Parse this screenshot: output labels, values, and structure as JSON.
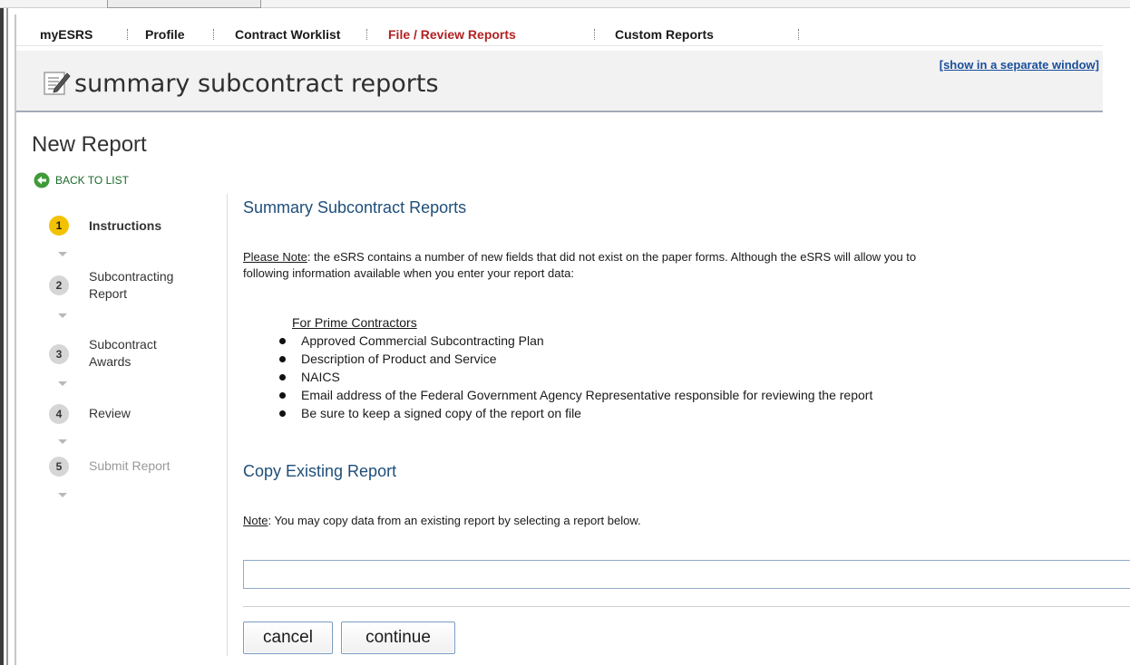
{
  "nav": {
    "items": [
      "myESRS",
      "Profile",
      "Contract Worklist",
      "File / Review Reports",
      "Custom Reports"
    ],
    "active_index": 3
  },
  "banner": {
    "title": "summary subcontract reports",
    "separate_window_link": "[show in a separate window]"
  },
  "page": {
    "heading": "New Report",
    "back_link": "BACK TO LIST"
  },
  "steps": [
    {
      "number": "1",
      "label_line1": "Instructions",
      "label_line2": "",
      "state": "current"
    },
    {
      "number": "2",
      "label_line1": "Subcontracting",
      "label_line2": "Report",
      "state": "enabled"
    },
    {
      "number": "3",
      "label_line1": "Subcontract",
      "label_line2": "Awards",
      "state": "enabled"
    },
    {
      "number": "4",
      "label_line1": "Review",
      "label_line2": "",
      "state": "enabled"
    },
    {
      "number": "5",
      "label_line1": "Submit Report",
      "label_line2": "",
      "state": "disabled"
    }
  ],
  "main": {
    "section1_title": "Summary Subcontract Reports",
    "note_label": "Please Note",
    "note_text_line1": ": the eSRS contains a number of new fields that did not exist on the paper forms. Although the eSRS will allow you to",
    "note_text_line2": "following information available when you enter your report data:",
    "list_heading": "For Prime Contractors",
    "list_items": [
      "Approved Commercial Subcontracting Plan",
      "Description of Product and Service",
      "NAICS",
      "Email address of the Federal Government Agency Representative responsible for reviewing the report",
      "Be sure to keep a signed copy of the report on file"
    ],
    "section2_title": "Copy Existing Report",
    "copy_note_label": "Note",
    "copy_note_text": ": You may copy data from an existing report by selecting a report below.",
    "select_value": ""
  },
  "buttons": {
    "cancel": "cancel",
    "continue": "continue"
  },
  "colors": {
    "active_nav": "#b22222",
    "heading_blue": "#1f4e79",
    "current_step": "#f2c200",
    "link_blue": "#1a4e9b",
    "back_green": "#1a6a2a"
  }
}
